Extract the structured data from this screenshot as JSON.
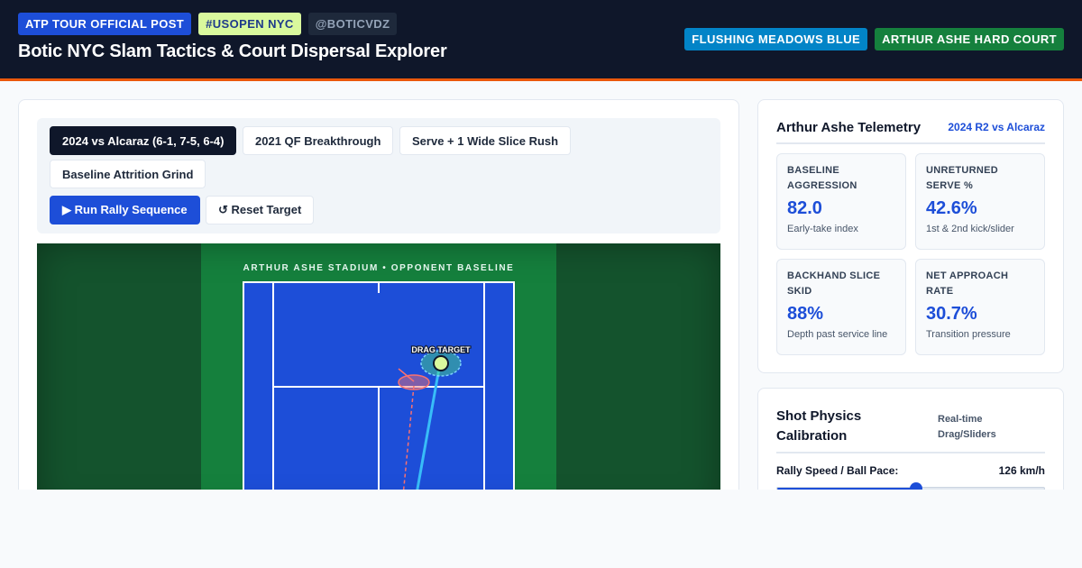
{
  "header": {
    "tags": [
      "ATP TOUR OFFICIAL POST",
      "#USOPEN NYC",
      "@BOTICVDZ"
    ],
    "title": "Botic NYC Slam Tactics & Court Dispersal Explorer",
    "right_tags": [
      "FLUSHING MEADOWS BLUE",
      "ARTHUR ASHE HARD COURT"
    ]
  },
  "scenarios": [
    "2024 vs Alcaraz (6-1, 7-5, 6-4)",
    "2021 QF Breakthrough",
    "Serve + 1 Wide Slice Rush",
    "Baseline Attrition Grind"
  ],
  "active_scenario": 0,
  "actions": {
    "run": "▶ Run Rally Sequence",
    "reset": "↺ Reset Target"
  },
  "court": {
    "stadium_label": "ARTHUR ASHE STADIUM • OPPONENT BASELINE",
    "target_label": "DRAG TARGET"
  },
  "telemetry": {
    "title": "Arthur Ashe Telemetry",
    "match_link": "2024 R2 vs Alcaraz",
    "metrics": [
      {
        "label": "BASELINE AGGRESSION",
        "value": "82.0",
        "sub": "Early-take index"
      },
      {
        "label": "UNRETURNED SERVE %",
        "value": "42.6%",
        "sub": "1st & 2nd kick/slider"
      },
      {
        "label": "BACKHAND SLICE SKID",
        "value": "88%",
        "sub": "Depth past service line"
      },
      {
        "label": "NET APPROACH RATE",
        "value": "30.7%",
        "sub": "Transition pressure"
      }
    ]
  },
  "physics": {
    "title": "Shot Physics Calibration",
    "note": "Real-time Drag/Sliders",
    "slider_label": "Rally Speed / Ball Pace:",
    "slider_value": "126 km/h",
    "slider_fraction": 0.52
  },
  "colors": {
    "header_bg": "#0f172a",
    "accent_orange": "#ea580c",
    "court_blue": "#1d4ed8",
    "court_green": "#15803d",
    "ball": "#d9f99d",
    "shot_path": "#38bdf8",
    "alt_path": "#f87171"
  },
  "icons": [
    "play-icon",
    "reset-icon"
  ]
}
